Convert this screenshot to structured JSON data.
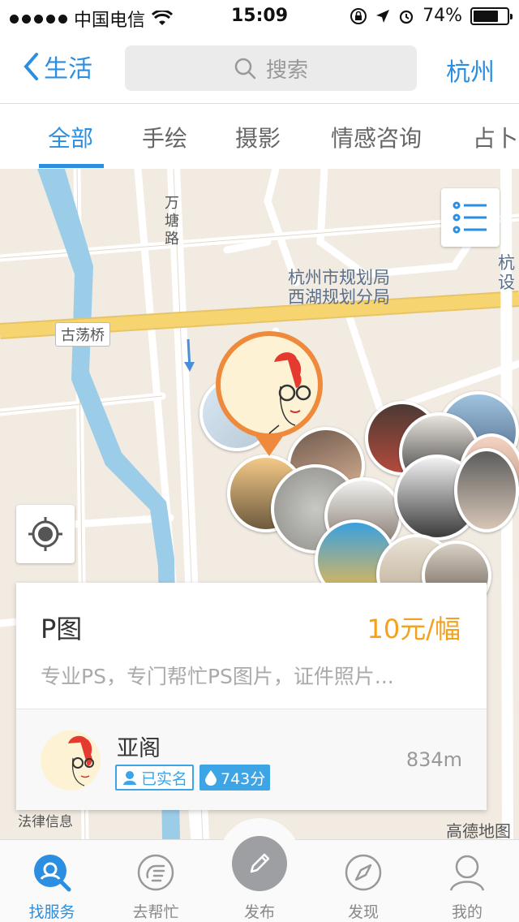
{
  "status_bar": {
    "carrier": "中国电信",
    "time": "15:09",
    "battery_pct": "74%",
    "battery_fill": 0.74
  },
  "nav": {
    "back_label": "生活",
    "search_placeholder": "搜索",
    "city": "杭州"
  },
  "tabs": [
    {
      "label": "全部",
      "active": true
    },
    {
      "label": "手绘",
      "active": false
    },
    {
      "label": "摄影",
      "active": false
    },
    {
      "label": "情感咨询",
      "active": false
    },
    {
      "label": "占卜",
      "active": false
    }
  ],
  "map": {
    "road_label_vertical": "万塘路",
    "bridge_label": "古荡桥",
    "poi_line1": "杭州市规划局",
    "poi_line2": "西湖规划分局",
    "edge_label_1": "杭",
    "edge_label_2": "设",
    "legal_info": "法律信息",
    "map_brand": "高德地图"
  },
  "card": {
    "title": "P图",
    "price": "10元/幅",
    "description": "专业PS，专门帮忙PS图片，证件照片...",
    "user_name": "亚阁",
    "verified_label": "已实名",
    "score_label": "743分",
    "distance": "834m"
  },
  "tabbar": {
    "items": [
      {
        "label": "找服务",
        "icon": "find-service-icon",
        "active": true
      },
      {
        "label": "去帮忙",
        "icon": "help-hand-icon",
        "active": false
      },
      {
        "label": "发布",
        "icon": "pencil-icon",
        "active": false
      },
      {
        "label": "发现",
        "icon": "compass-icon",
        "active": false
      },
      {
        "label": "我的",
        "icon": "person-icon",
        "active": false
      }
    ]
  },
  "colors": {
    "accent": "#2b8ee0",
    "price": "#f5a11d",
    "pin_border": "#ef8a3c",
    "map_bg": "#f1ebe2",
    "road_yellow": "#f6d470",
    "river": "#9ccde8"
  }
}
